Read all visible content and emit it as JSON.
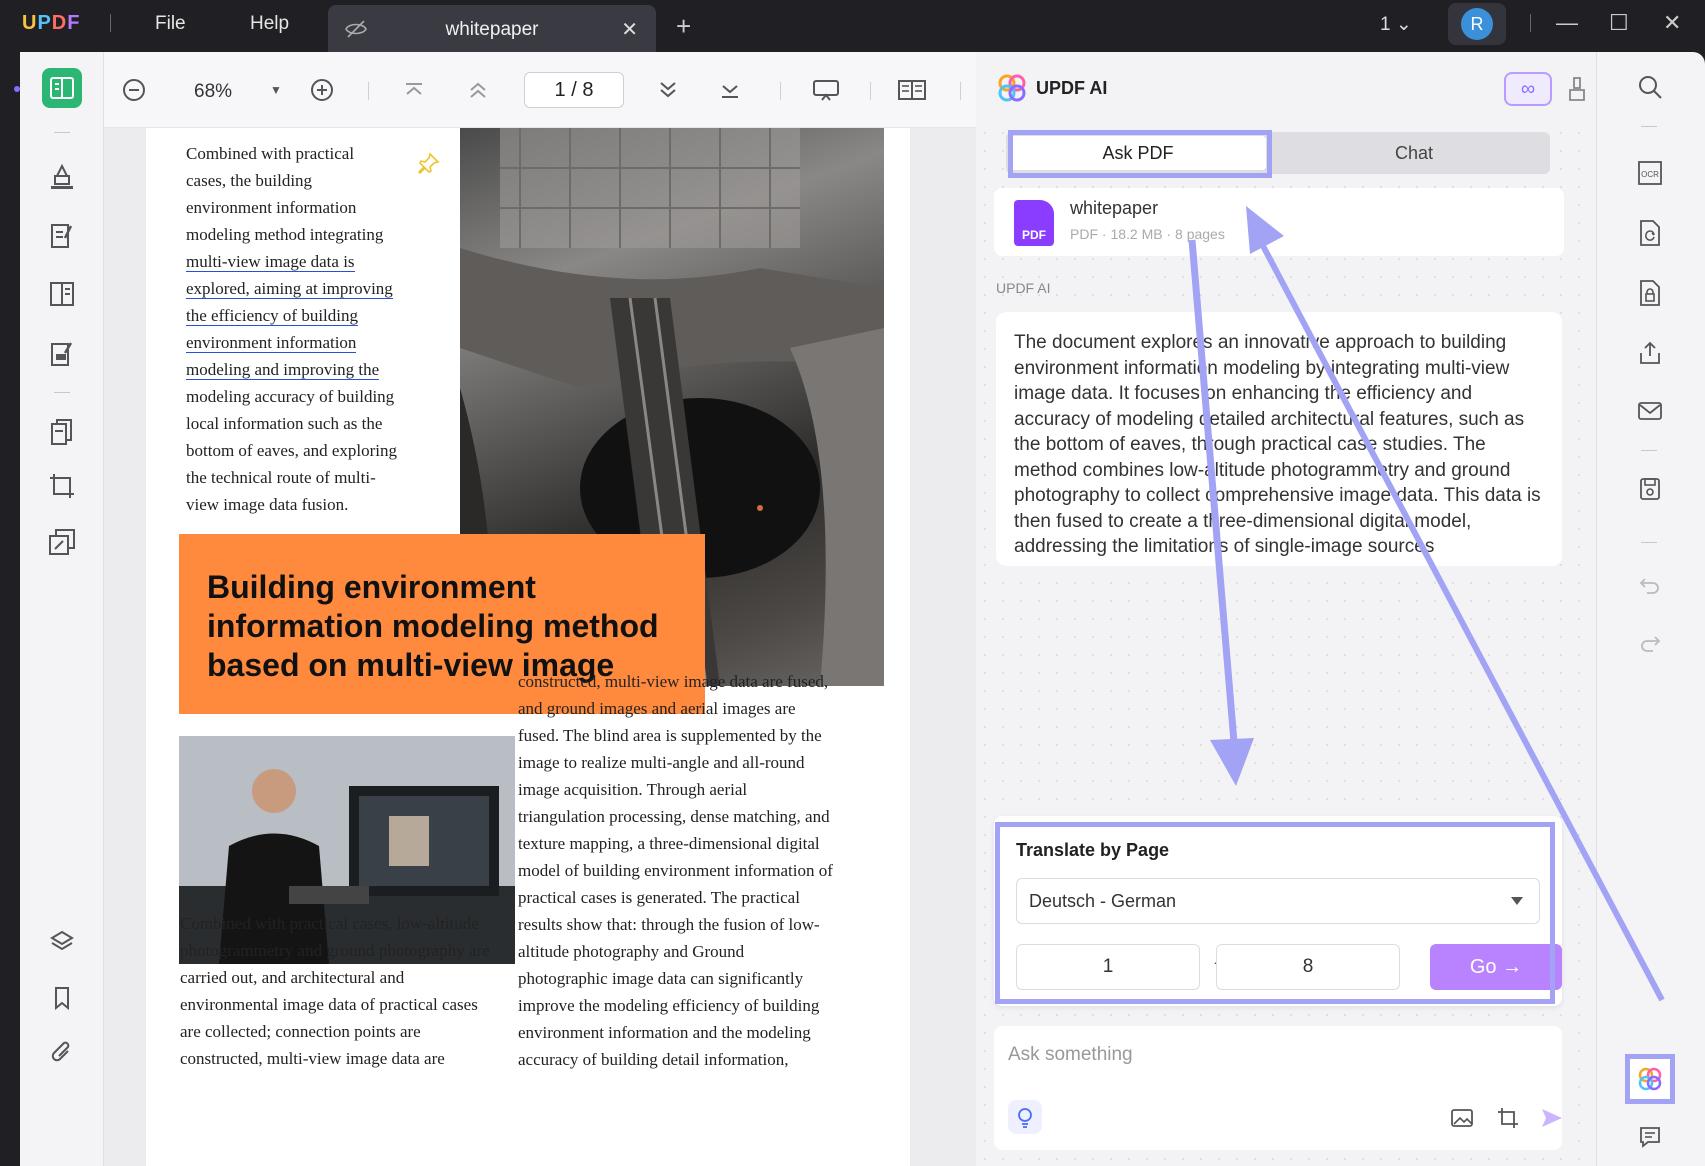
{
  "titlebar": {
    "app_name_parts": [
      "U",
      "P",
      "D",
      "F"
    ],
    "menu_file": "File",
    "menu_help": "Help",
    "tab_title": "whitepaper",
    "tab_close": "✕",
    "tab_add": "+",
    "page_count": "1",
    "avatar_initial": "R"
  },
  "toolbar": {
    "zoom": "68%",
    "page_indicator": "1 / 8"
  },
  "document": {
    "col1_lines": [
      "Combined with practical",
      "cases, the building",
      "environment information",
      "modeling method integrating"
    ],
    "col1_underlined": [
      "multi-view image data is",
      "explored, aiming at improving",
      "the efficiency of building",
      "environment information",
      "modeling and improving the"
    ],
    "col1_tail": [
      "modeling accuracy of building",
      "local information such as the",
      "bottom of eaves, and exploring",
      "the technical route of multi-",
      "view image data fusion."
    ],
    "banner_title": "Building environment information modeling method based on multi-view image",
    "bottom_left": "Combined with practical cases, low-altitude photogrammetry and ground photography are carried out, and architectural and environmental image data of practical cases are collected; connection points are constructed, multi-view image data are",
    "right_col": "constructed, multi-view image data are fused, and ground images and aerial images are fused. The blind area is supplemented by the image to realize multi-angle and all-round image acquisition. Through aerial triangulation processing, dense matching, and texture mapping, a three-dimensional digital model of building environment information of practical cases is generated. The practical results show that: through the fusion of low-altitude photography and Ground photographic image data can significantly improve the modeling efficiency of building environment information and the modeling accuracy of building detail information,"
  },
  "ai_panel": {
    "title": "UPDF AI",
    "tab_ask": "Ask PDF",
    "tab_chat": "Chat",
    "file_name": "whitepaper",
    "file_meta": "PDF · 18.2 MB · 8 pages",
    "file_badge": "PDF",
    "source_label": "UPDF AI",
    "answer": "The document explores an innovative approach to building environment information modeling by integrating multi-view image data. It focuses on enhancing the efficiency and accuracy of modeling detailed architectural features, such as the bottom of eaves, through practical case studies. The method combines low-altitude photogrammetry and ground photography to collect comprehensive image data. This data is then fused to create a three-dimensional digital model, addressing the limitations of single-image sources",
    "translate": {
      "title": "Translate by Page",
      "language": "Deutsch - German",
      "from_page": "1",
      "to_page": "8",
      "dash": "-",
      "go_label": "Go →"
    },
    "ask_placeholder": "Ask something"
  },
  "colors": {
    "accent": "#8a6cff",
    "highlight_box": "#a3a3f5",
    "banner": "#ff8a3d",
    "go_button": "#b983ff",
    "active_tool": "#2bb673"
  }
}
